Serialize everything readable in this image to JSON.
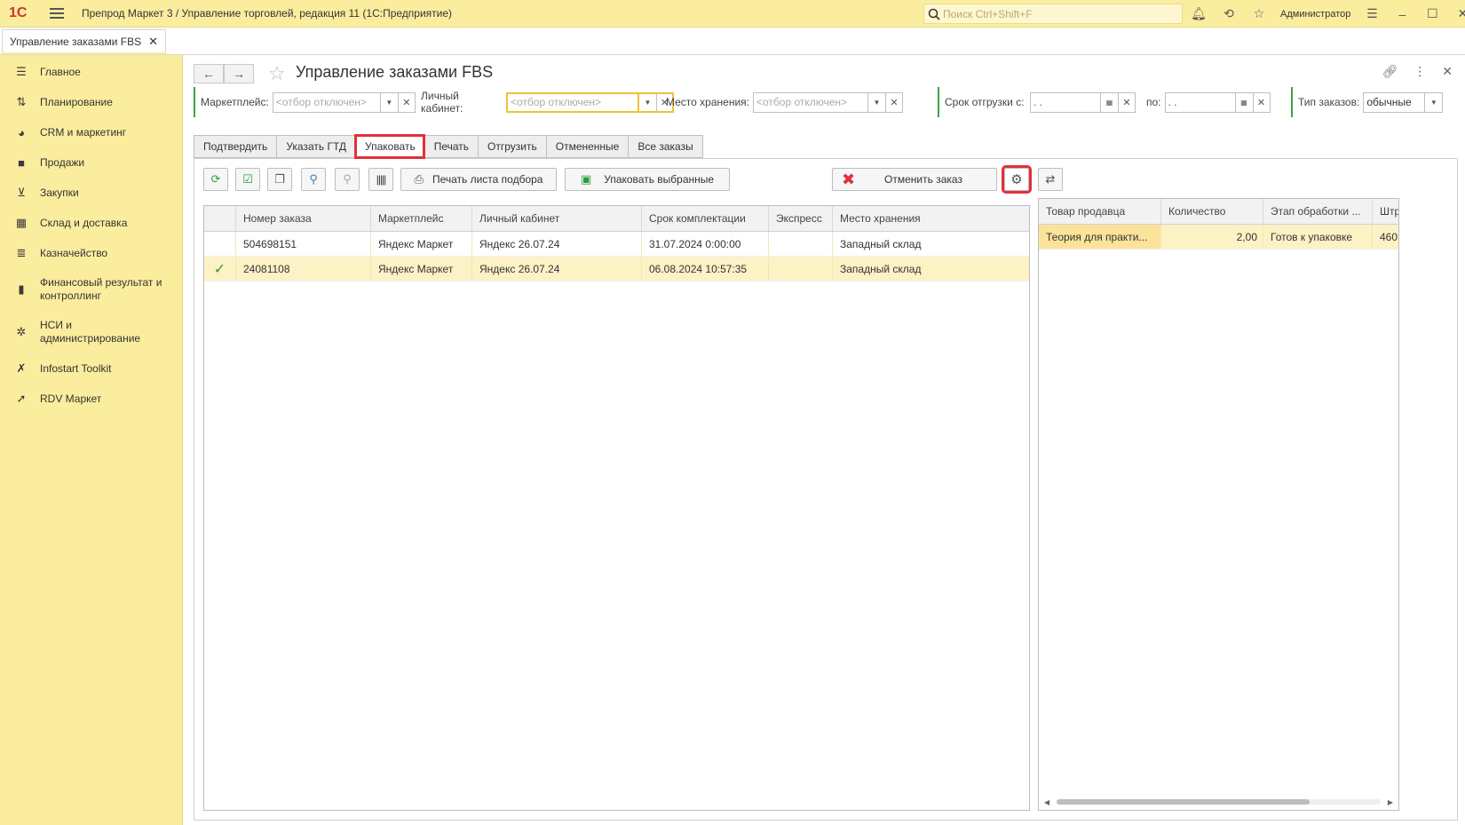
{
  "app": {
    "title": "Препрод Маркет 3 / Управление торговлей, редакция 11  (1С:Предприятие)",
    "logo_text": "1С",
    "search_placeholder": "Поиск Ctrl+Shift+F",
    "user": "Администратор"
  },
  "open_tab": {
    "label": "Управление заказами FBS"
  },
  "sidebar": {
    "items": [
      {
        "label": "Главное",
        "icon": "menu-lines-icon"
      },
      {
        "label": "Планирование",
        "icon": "planning-icon"
      },
      {
        "label": "CRM и маркетинг",
        "icon": "pie-chart-icon"
      },
      {
        "label": "Продажи",
        "icon": "shopping-bag-icon"
      },
      {
        "label": "Закупки",
        "icon": "cart-icon"
      },
      {
        "label": "Склад и доставка",
        "icon": "warehouse-icon"
      },
      {
        "label": "Казначейство",
        "icon": "coins-icon"
      },
      {
        "label": "Финансовый результат и контроллинг",
        "icon": "bar-chart-icon"
      },
      {
        "label": "НСИ и администрирование",
        "icon": "gear-icon"
      },
      {
        "label": "Infostart Toolkit",
        "icon": "tools-icon"
      },
      {
        "label": "RDV Маркет",
        "icon": "rocket-icon"
      }
    ]
  },
  "page": {
    "title": "Управление заказами FBS"
  },
  "filters": {
    "marketplace": {
      "label": "Маркетплейс:",
      "placeholder": "<отбор отключен>"
    },
    "cabinet": {
      "label": "Личный кабинет:",
      "placeholder": "<отбор отключен>"
    },
    "storage": {
      "label": "Место хранения:",
      "placeholder": "<отбор отключен>"
    },
    "ship_from": {
      "label": "Срок отгрузки с:",
      "value": " .  . "
    },
    "ship_to": {
      "label": "по:",
      "value": " .  . "
    },
    "order_type": {
      "label": "Тип заказов:",
      "value": "обычные"
    }
  },
  "action_tabs": [
    "Подтвердить",
    "Указать ГТД",
    "Упаковать",
    "Печать",
    "Отгрузить",
    "Отмененные",
    "Все заказы"
  ],
  "toolbar": {
    "print_pick_list": "Печать листа подбора",
    "pack_selected": "Упаковать выбранные",
    "cancel_order": "Отменить заказ"
  },
  "orders_table": {
    "columns": [
      "Номер заказа",
      "Маркетплейс",
      "Личный кабинет",
      "Срок комплектации",
      "Экспресс",
      "Место хранения"
    ],
    "rows": [
      {
        "checked": "",
        "number": "504698151",
        "marketplace": "Яндекс Маркет",
        "cabinet": "Яндекс 26.07.24",
        "deadline": "31.07.2024 0:00:00",
        "express": "",
        "storage": "Западный склад"
      },
      {
        "checked": "✓",
        "number": "24081108",
        "marketplace": "Яндекс Маркет",
        "cabinet": "Яндекс 26.07.24",
        "deadline": "06.08.2024 10:57:35",
        "express": "",
        "storage": "Западный склад"
      }
    ]
  },
  "items_table": {
    "columns": [
      "Товар продавца",
      "Количество",
      "Этап обработки ...",
      "Штр"
    ],
    "rows": [
      {
        "product": "Теория для практи...",
        "qty": "2,00",
        "stage": "Готов к упаковке",
        "barcode": "460"
      }
    ]
  }
}
